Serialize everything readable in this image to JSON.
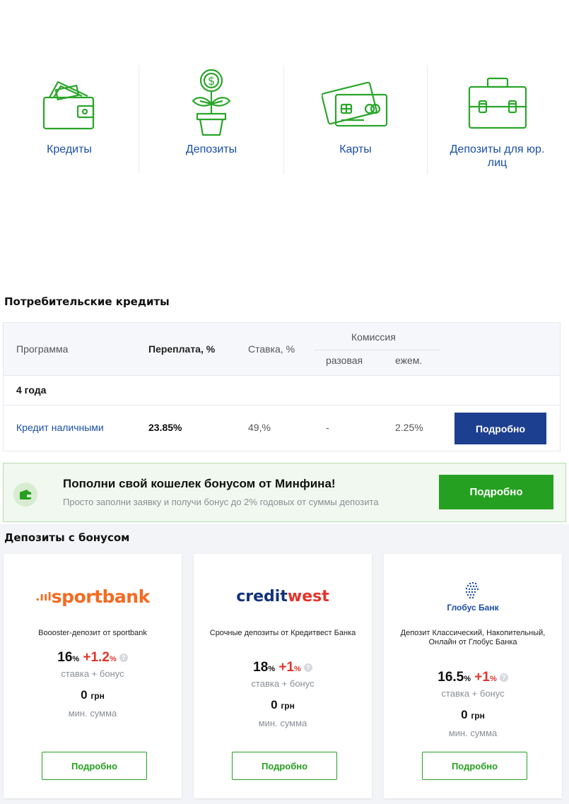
{
  "categories": [
    {
      "label": "Кредиты",
      "icon": "wallet-icon"
    },
    {
      "label": "Депозиты",
      "icon": "money-plant-icon"
    },
    {
      "label": "Карты",
      "icon": "cards-icon"
    },
    {
      "label": "Депозиты для юр. лиц",
      "icon": "briefcase-icon"
    }
  ],
  "credits": {
    "title": "Потребительские кредиты",
    "headers": {
      "program": "Программа",
      "overpay": "Переплата, %",
      "rate": "Ставка, %",
      "commission": "Комиссия",
      "one_time": "разовая",
      "monthly": "ежем."
    },
    "group": "4 года",
    "row": {
      "program": "Кредит наличными",
      "overpay": "23.85%",
      "rate": "49,%",
      "one_time": "-",
      "monthly": "2.25%",
      "button": "Подробно"
    }
  },
  "promo": {
    "title": "Пополни свой кошелек бонусом от Минфина!",
    "subtitle": "Просто заполни заявку и получи бонус до 2% годовых от суммы депозита",
    "button": "Подробно"
  },
  "deposits": {
    "title": "Депозиты с бонусом",
    "cards": [
      {
        "logo_text_a": ".ııl",
        "logo_text_b": "sportbank",
        "name": "Boooster-депозит от sportbank",
        "rate": "16",
        "bonus": "+1.2",
        "pct": "%",
        "rate_label": "ставка + бонус",
        "min": "0",
        "unit": "грн",
        "min_label": "мин. сумма",
        "button": "Подробно"
      },
      {
        "logo_text_a": "credit",
        "logo_text_b": "west",
        "name": "Срочные депозиты от Кредитвест Банка",
        "rate": "18",
        "bonus": "+1",
        "pct": "%",
        "rate_label": "ставка + бонус",
        "min": "0",
        "unit": "грн",
        "min_label": "мин. сумма",
        "button": "Подробно"
      },
      {
        "logo_text_a": "Глобус Банк",
        "logo_text_b": "",
        "name": "Депозит Классический, Накопительный, Онлайн от Глобус Банка",
        "rate": "16.5",
        "bonus": "+1",
        "pct": "%",
        "rate_label": "ставка + бонус",
        "min": "0",
        "unit": "грн",
        "min_label": "мин. сумма",
        "button": "Подробно"
      }
    ]
  },
  "colors": {
    "brand_green": "#26a020",
    "link_blue": "#1a4ea6",
    "button_blue": "#1d3f8f",
    "bonus_red": "#e0342b",
    "sportbank_orange": "#f36b21",
    "creditwest_navy": "#13337a"
  }
}
